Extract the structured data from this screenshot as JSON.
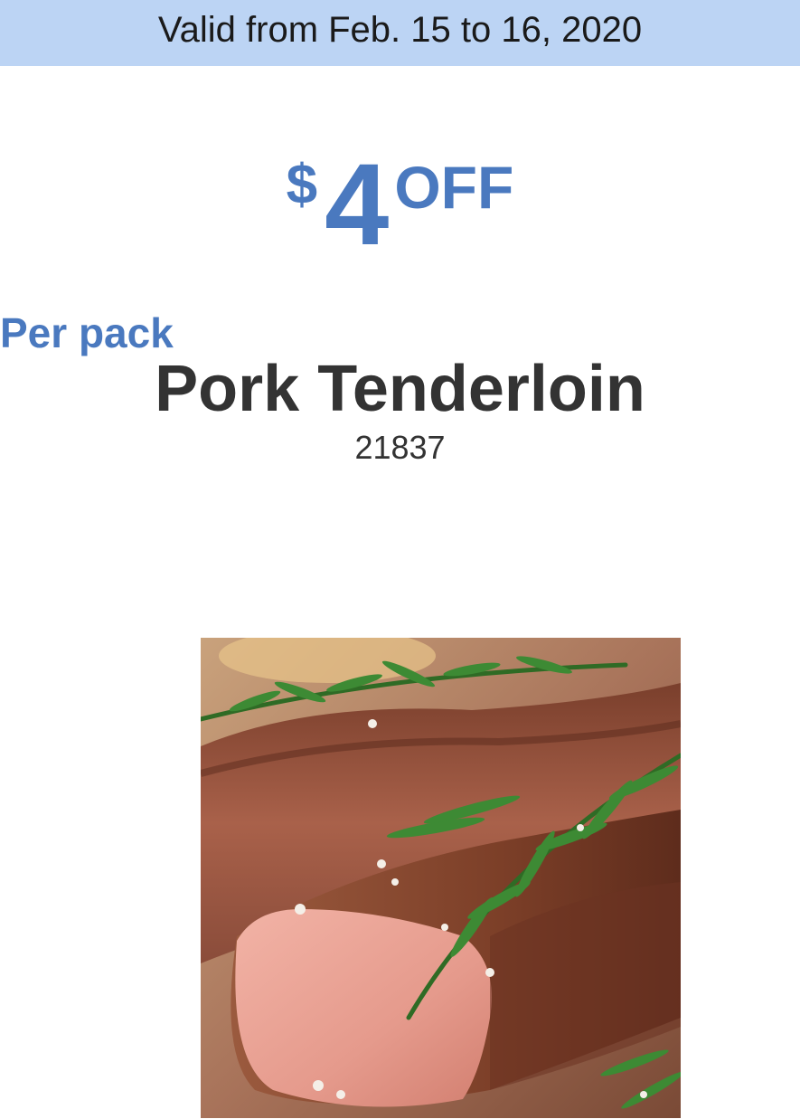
{
  "banner": {
    "validity": "Valid from Feb. 15 to 16, 2020"
  },
  "offer": {
    "currency": "$",
    "amount": "4",
    "off_label": "OFF",
    "unit": "Per pack"
  },
  "product": {
    "name": "Pork Tenderloin",
    "code": "21837",
    "image_icon": "pork-tenderloin-photo"
  },
  "colors": {
    "banner_bg": "#bcd4f4",
    "accent": "#4a79bf",
    "text": "#333333"
  }
}
